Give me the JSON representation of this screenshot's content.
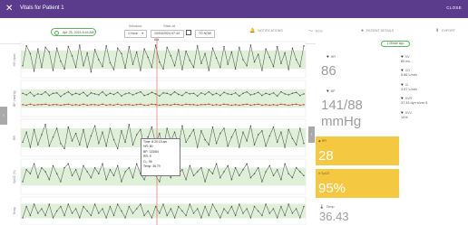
{
  "window": {
    "close_glyph": "✕",
    "title": "Vitals for Patient 1",
    "close_label": "CLOSE",
    "bar_color": "#5b3b8c"
  },
  "toolbar": {
    "date_value": "Apr 25, 2024 8:44 AM",
    "window_label": "Window",
    "window_value": "1 Hour",
    "start_label": "Start at",
    "start_value": "10/04/2024 07:44 AM",
    "now_label": "TO NOW",
    "items": [
      {
        "icon": "bell-icon",
        "glyph": "🔔",
        "label": "NOTIFICATIONS",
        "color": "#f0a020"
      },
      {
        "icon": "trend-icon",
        "glyph": "〜",
        "label": "ECG"
      },
      {
        "icon": "person-icon",
        "glyph": "●",
        "label": "PATIENT DETAILS"
      },
      {
        "icon": "download-icon",
        "glyph": "⬇",
        "label": "EXPORT"
      }
    ]
  },
  "tooltip": {
    "lines": [
      "Time: 8:20:19 am",
      "HR: 80",
      "BP: 133/84",
      "RR: 9",
      "O₂: 96",
      "Temp: 36.79"
    ]
  },
  "chart_data": [
    {
      "type": "line",
      "ylabel": "HR (bpm)",
      "series": [
        {
          "name": "HR",
          "color": "#555555",
          "values": [
            72,
            98,
            88,
            65,
            94,
            70,
            96,
            90,
            66,
            95,
            78,
            68,
            97,
            85,
            70,
            99,
            72,
            89,
            64,
            93,
            80,
            71,
            98,
            76,
            67,
            95,
            88,
            69,
            97,
            74,
            90,
            66,
            94,
            83,
            70,
            99,
            77,
            68,
            96,
            85,
            72,
            93,
            67,
            91,
            79,
            70,
            98,
            75,
            88,
            66,
            95,
            82,
            70,
            97,
            74,
            90,
            68,
            96,
            80,
            72,
            99,
            77,
            87,
            66,
            94,
            83,
            71,
            97,
            75,
            89,
            67,
            95,
            80,
            71,
            98
          ]
        }
      ],
      "ylim": [
        60,
        100
      ]
    },
    {
      "type": "line",
      "ylabel": "BP (mmHg)",
      "series": [
        {
          "name": "Systolic",
          "color": "#555555",
          "values": [
            140,
            137,
            142,
            135,
            139,
            138,
            143,
            136,
            140,
            141,
            134,
            139,
            143,
            137,
            140,
            138,
            142,
            135,
            141,
            139,
            137,
            143,
            136,
            140,
            138,
            142,
            135,
            139,
            141,
            137,
            140,
            143,
            136,
            138,
            142,
            139,
            135,
            141,
            140,
            137,
            143,
            138,
            136,
            142,
            139,
            140,
            135,
            141,
            138,
            143,
            137,
            140,
            136,
            142,
            139,
            138,
            141,
            135,
            140,
            143,
            137,
            139,
            142,
            136,
            140,
            138,
            141,
            135,
            143,
            139,
            137,
            140,
            142,
            136,
            139
          ]
        },
        {
          "name": "Diastolic",
          "color": "#c0392b",
          "values": [
            118,
            117,
            119,
            117,
            118,
            118,
            119,
            117,
            118,
            118,
            117,
            118,
            119,
            117,
            118,
            117,
            119,
            117,
            118,
            118,
            117,
            119,
            117,
            118,
            117,
            119,
            117,
            118,
            118,
            117,
            118,
            119,
            117,
            117,
            119,
            118,
            117,
            118,
            118,
            117,
            119,
            118,
            117,
            119,
            118,
            118,
            117,
            118,
            118,
            119,
            117,
            118,
            117,
            119,
            118,
            117,
            118,
            117,
            118,
            119,
            117,
            118,
            119,
            117,
            118,
            117,
            118,
            117,
            119,
            118,
            117,
            118,
            119,
            117,
            118
          ]
        }
      ],
      "ylim": [
        100,
        160
      ]
    },
    {
      "type": "line",
      "ylabel": "RR",
      "series": [
        {
          "name": "RR",
          "color": "#555555",
          "values": [
            14,
            22,
            10,
            24,
            12,
            20,
            28,
            11,
            18,
            25,
            13,
            9,
            26,
            15,
            21,
            12,
            24,
            10,
            19,
            27,
            13,
            22,
            11,
            25,
            16,
            9,
            23,
            14,
            28,
            12,
            20,
            24,
            10,
            18,
            26,
            13,
            21,
            9,
            25,
            15,
            22,
            11,
            27,
            14,
            19,
            24,
            10,
            23,
            16,
            12,
            26,
            13,
            21,
            25,
            11,
            18,
            24,
            10,
            22,
            15,
            27,
            12,
            20,
            23,
            11,
            19,
            26,
            14,
            22,
            10,
            24,
            17,
            12,
            25,
            13
          ]
        }
      ],
      "ylim": [
        5,
        30
      ]
    },
    {
      "type": "line",
      "ylabel": "SpO2 (%)",
      "series": [
        {
          "name": "SpO2",
          "color": "#555555",
          "values": [
            90,
            96,
            94,
            99,
            92,
            97,
            95,
            91,
            98,
            94,
            90,
            97,
            99,
            93,
            96,
            91,
            98,
            95,
            92,
            97,
            94,
            99,
            91,
            96,
            93,
            98,
            90,
            95,
            97,
            92,
            99,
            94,
            91,
            96,
            98,
            93,
            90,
            97,
            95,
            92,
            99,
            94,
            96,
            91,
            98,
            93,
            95,
            97,
            90,
            96,
            94,
            99,
            92,
            95,
            98,
            91,
            97,
            93,
            96,
            99,
            92,
            94,
            97,
            90,
            95,
            98,
            93,
            96,
            91,
            99,
            94,
            92,
            97,
            95,
            93
          ]
        }
      ],
      "ylim": [
        85,
        100
      ]
    },
    {
      "type": "line",
      "ylabel": "Temp",
      "series": [
        {
          "name": "Temp",
          "color": "#555555",
          "values": [
            36.4,
            36.9,
            36.5,
            37.0,
            36.6,
            36.8,
            36.5,
            37.0,
            36.4,
            36.7,
            36.9,
            36.5,
            37.0,
            36.6,
            36.8,
            36.4,
            36.9,
            36.7,
            36.5,
            37.0,
            36.6,
            36.8,
            36.4,
            36.9,
            36.5,
            37.0,
            36.7,
            36.4,
            36.9,
            36.6,
            36.8,
            37.0,
            36.5,
            36.7,
            36.4,
            36.9,
            36.6,
            37.0,
            36.5,
            36.8,
            36.4,
            36.9,
            36.7,
            36.5,
            37.0,
            36.6,
            36.8,
            36.4,
            36.9,
            36.5,
            37.0,
            36.7,
            36.4,
            36.8,
            36.6,
            36.9,
            36.5,
            37.0,
            36.6,
            36.8,
            36.4,
            36.9,
            36.7,
            36.5,
            37.0,
            36.6,
            36.8,
            36.4,
            36.9,
            36.5,
            37.0,
            36.6,
            36.8,
            36.4,
            36.9
          ]
        }
      ],
      "ylim": [
        36.2,
        37.2
      ]
    }
  ],
  "right_panel": {
    "update_badge": "1 Minute ago",
    "hr": {
      "label": "HR",
      "value": "86"
    },
    "bp": {
      "label": "BP",
      "value": "141/88",
      "unit": "mmHg"
    },
    "sv": {
      "label": "SV",
      "value": "80 mL"
    },
    "co": {
      "label": "CO",
      "value": "5.86 L/min"
    },
    "ci": {
      "label": "CI",
      "value": "3.57 L/min"
    },
    "svr": {
      "label": "SVR",
      "value": "37.33 dyn·s/cm·5"
    },
    "svv": {
      "label": "SVV",
      "value": "10%"
    },
    "rr": {
      "label": "RR",
      "value": "28"
    },
    "spo2": {
      "label": "SpO2",
      "value": "95%"
    },
    "temp": {
      "label": "Temp",
      "value": "36.43"
    },
    "card_color": "#f5c842"
  }
}
